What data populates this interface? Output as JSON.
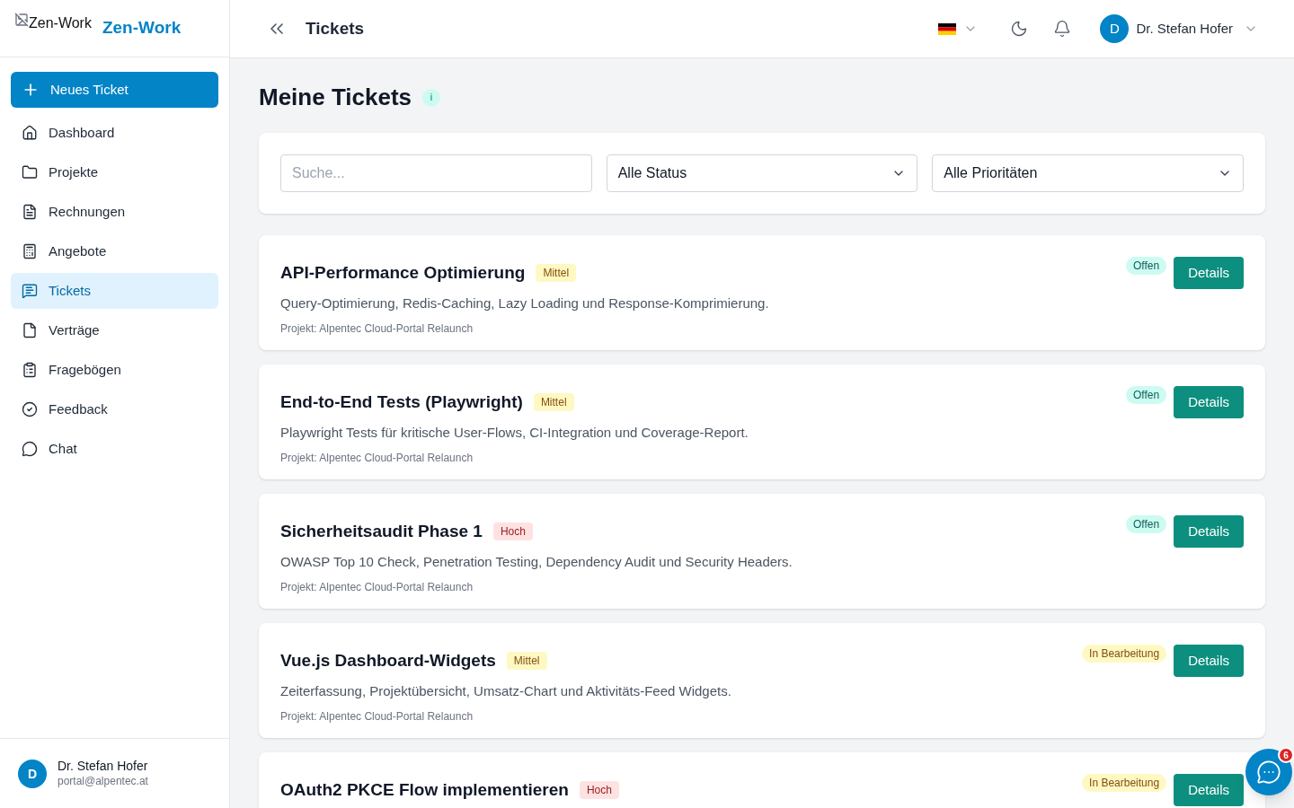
{
  "sidebar": {
    "logo_alt": "Zen-Work",
    "brand": "Zen-Work",
    "new_button": "Neues Ticket",
    "items": [
      {
        "label": "Dashboard",
        "selected": false
      },
      {
        "label": "Projekte",
        "selected": false
      },
      {
        "label": "Rechnungen",
        "selected": false
      },
      {
        "label": "Angebote",
        "selected": false
      },
      {
        "label": "Tickets",
        "selected": true
      },
      {
        "label": "Verträge",
        "selected": false
      },
      {
        "label": "Fragebögen",
        "selected": false
      },
      {
        "label": "Feedback",
        "selected": false
      },
      {
        "label": "Chat",
        "selected": false
      }
    ],
    "user": {
      "initial": "D",
      "name": "Dr. Stefan Hofer",
      "email": "portal@alpentec.at"
    }
  },
  "header": {
    "title": "Tickets",
    "user": {
      "initial": "D",
      "name": "Dr. Stefan Hofer"
    }
  },
  "page": {
    "title": "Meine Tickets",
    "info": "i"
  },
  "filters": {
    "search_placeholder": "Suche...",
    "status": "Alle Status",
    "priority": "Alle Prioritäten"
  },
  "tickets": [
    {
      "title": "API-Performance Optimierung",
      "priority": {
        "label": "Mittel",
        "kind": "medium"
      },
      "status": {
        "label": "Offen",
        "kind": "open"
      },
      "description": "Query-Optimierung, Redis-Caching, Lazy Loading und Response-Komprimierung.",
      "project": "Projekt: Alpentec Cloud-Portal Relaunch",
      "button": "Details"
    },
    {
      "title": "End-to-End Tests (Playwright)",
      "priority": {
        "label": "Mittel",
        "kind": "medium"
      },
      "status": {
        "label": "Offen",
        "kind": "open"
      },
      "description": "Playwright Tests für kritische User-Flows, CI-Integration und Coverage-Report.",
      "project": "Projekt: Alpentec Cloud-Portal Relaunch",
      "button": "Details"
    },
    {
      "title": "Sicherheitsaudit Phase 1",
      "priority": {
        "label": "Hoch",
        "kind": "high"
      },
      "status": {
        "label": "Offen",
        "kind": "open"
      },
      "description": "OWASP Top 10 Check, Penetration Testing, Dependency Audit und Security Headers.",
      "project": "Projekt: Alpentec Cloud-Portal Relaunch",
      "button": "Details"
    },
    {
      "title": "Vue.js Dashboard-Widgets",
      "priority": {
        "label": "Mittel",
        "kind": "medium"
      },
      "status": {
        "label": "In Bearbeitung",
        "kind": "in_progress"
      },
      "description": "Zeiterfassung, Projektübersicht, Umsatz-Chart und Aktivitäts-Feed Widgets.",
      "project": "Projekt: Alpentec Cloud-Portal Relaunch",
      "button": "Details"
    },
    {
      "title": "OAuth2 PKCE Flow implementieren",
      "priority": {
        "label": "Hoch",
        "kind": "high"
      },
      "status": {
        "label": "In Bearbeitung",
        "kind": "in_progress"
      },
      "button": "Details"
    }
  ],
  "chat_fab": {
    "badge": "6"
  }
}
